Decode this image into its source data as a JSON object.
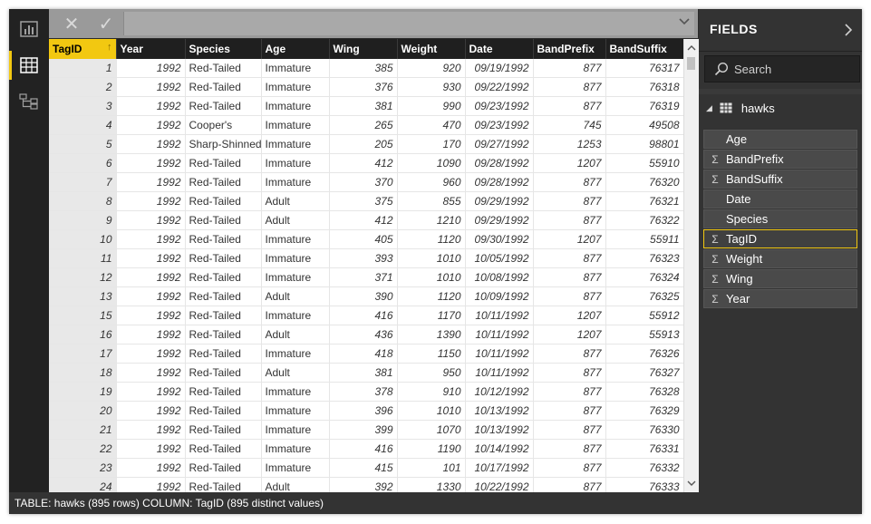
{
  "formula_bar": {
    "cancel_glyph": "✕",
    "commit_glyph": "✓",
    "value": ""
  },
  "grid": {
    "columns": [
      "TagID",
      "Year",
      "Species",
      "Age",
      "Wing",
      "Weight",
      "Date",
      "BandPrefix",
      "BandSuffix"
    ],
    "sorted_column_indicator": "↑",
    "rows": [
      [
        "1",
        "1992",
        "Red-Tailed",
        "Immature",
        "385",
        "920",
        "09/19/1992",
        "877",
        "76317"
      ],
      [
        "2",
        "1992",
        "Red-Tailed",
        "Immature",
        "376",
        "930",
        "09/22/1992",
        "877",
        "76318"
      ],
      [
        "3",
        "1992",
        "Red-Tailed",
        "Immature",
        "381",
        "990",
        "09/23/1992",
        "877",
        "76319"
      ],
      [
        "4",
        "1992",
        "Cooper's",
        "Immature",
        "265",
        "470",
        "09/23/1992",
        "745",
        "49508"
      ],
      [
        "5",
        "1992",
        "Sharp-Shinned",
        "Immature",
        "205",
        "170",
        "09/27/1992",
        "1253",
        "98801"
      ],
      [
        "6",
        "1992",
        "Red-Tailed",
        "Immature",
        "412",
        "1090",
        "09/28/1992",
        "1207",
        "55910"
      ],
      [
        "7",
        "1992",
        "Red-Tailed",
        "Immature",
        "370",
        "960",
        "09/28/1992",
        "877",
        "76320"
      ],
      [
        "8",
        "1992",
        "Red-Tailed",
        "Adult",
        "375",
        "855",
        "09/29/1992",
        "877",
        "76321"
      ],
      [
        "9",
        "1992",
        "Red-Tailed",
        "Adult",
        "412",
        "1210",
        "09/29/1992",
        "877",
        "76322"
      ],
      [
        "10",
        "1992",
        "Red-Tailed",
        "Immature",
        "405",
        "1120",
        "09/30/1992",
        "1207",
        "55911"
      ],
      [
        "11",
        "1992",
        "Red-Tailed",
        "Immature",
        "393",
        "1010",
        "10/05/1992",
        "877",
        "76323"
      ],
      [
        "12",
        "1992",
        "Red-Tailed",
        "Immature",
        "371",
        "1010",
        "10/08/1992",
        "877",
        "76324"
      ],
      [
        "13",
        "1992",
        "Red-Tailed",
        "Adult",
        "390",
        "1120",
        "10/09/1992",
        "877",
        "76325"
      ],
      [
        "15",
        "1992",
        "Red-Tailed",
        "Immature",
        "416",
        "1170",
        "10/11/1992",
        "1207",
        "55912"
      ],
      [
        "16",
        "1992",
        "Red-Tailed",
        "Adult",
        "436",
        "1390",
        "10/11/1992",
        "1207",
        "55913"
      ],
      [
        "17",
        "1992",
        "Red-Tailed",
        "Immature",
        "418",
        "1150",
        "10/11/1992",
        "877",
        "76326"
      ],
      [
        "18",
        "1992",
        "Red-Tailed",
        "Adult",
        "381",
        "950",
        "10/11/1992",
        "877",
        "76327"
      ],
      [
        "19",
        "1992",
        "Red-Tailed",
        "Immature",
        "378",
        "910",
        "10/12/1992",
        "877",
        "76328"
      ],
      [
        "20",
        "1992",
        "Red-Tailed",
        "Immature",
        "396",
        "1010",
        "10/13/1992",
        "877",
        "76329"
      ],
      [
        "21",
        "1992",
        "Red-Tailed",
        "Immature",
        "399",
        "1070",
        "10/13/1992",
        "877",
        "76330"
      ],
      [
        "22",
        "1992",
        "Red-Tailed",
        "Immature",
        "416",
        "1190",
        "10/14/1992",
        "877",
        "76331"
      ],
      [
        "23",
        "1992",
        "Red-Tailed",
        "Immature",
        "415",
        "101",
        "10/17/1992",
        "877",
        "76332"
      ],
      [
        "24",
        "1992",
        "Red-Tailed",
        "Adult",
        "392",
        "1330",
        "10/22/1992",
        "877",
        "76333"
      ]
    ]
  },
  "fields_pane": {
    "title": "FIELDS",
    "search_placeholder": "Search",
    "table_name": "hawks",
    "fields": [
      {
        "label": "Age",
        "sigma": ""
      },
      {
        "label": "BandPrefix",
        "sigma": "Σ"
      },
      {
        "label": "BandSuffix",
        "sigma": "Σ"
      },
      {
        "label": "Date",
        "sigma": ""
      },
      {
        "label": "Species",
        "sigma": ""
      },
      {
        "label": "TagID",
        "sigma": "Σ"
      },
      {
        "label": "Weight",
        "sigma": "Σ"
      },
      {
        "label": "Wing",
        "sigma": "Σ"
      },
      {
        "label": "Year",
        "sigma": "Σ"
      }
    ],
    "selected_field": "TagID"
  },
  "status_bar": {
    "text": "TABLE: hawks (895 rows) COLUMN: TagID (895 distinct values)"
  },
  "colors": {
    "accent": "#f2c811",
    "header_bg": "#1f1f1f",
    "pane_bg": "#333333"
  }
}
